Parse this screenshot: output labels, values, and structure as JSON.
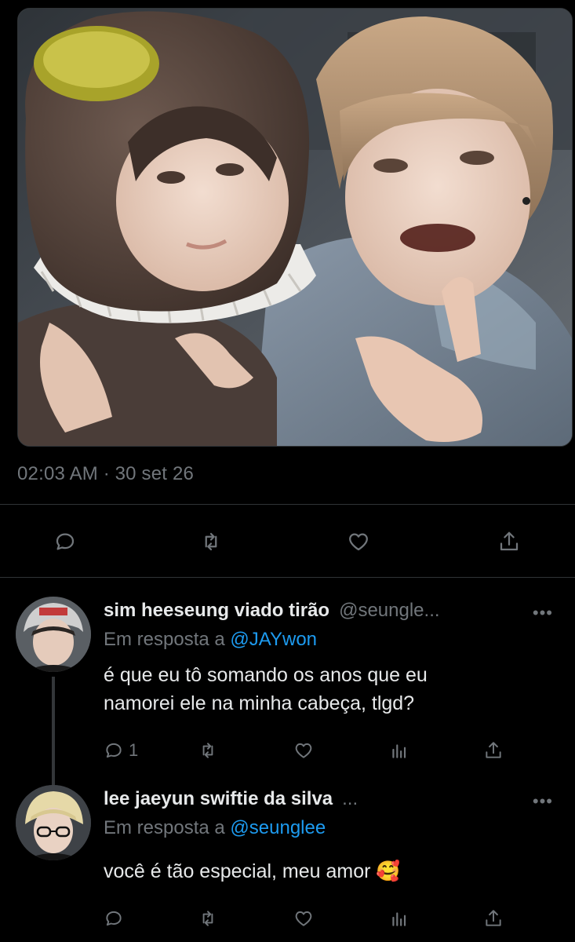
{
  "tweet": {
    "time": "02:03 AM",
    "separator": "·",
    "date": "30 set 26",
    "actions": [
      "reply-icon",
      "retweet-icon",
      "like-icon",
      "share-icon"
    ]
  },
  "replies": [
    {
      "author": "sim heeseung viado tirão",
      "handle": "@seungle...",
      "more": "•••",
      "reply_prefix": "Em resposta a",
      "reply_to": "@JAYwon",
      "lines": [
        "é que eu tô somando os anos que eu",
        "namorei ele na minha cabeça, tlgd?"
      ],
      "reply_count": "1"
    },
    {
      "author": "lee jaeyun swiftie da silva",
      "handle": "...",
      "more": "•••",
      "reply_prefix": "Em resposta a",
      "reply_to": "@seunglee",
      "text": "você é tão especial, meu amor 🥰"
    }
  ],
  "colors": {
    "background": "#000000",
    "text": "#e7e9ea",
    "muted": "#71767b",
    "link": "#1d9bf0",
    "border": "#2f3336"
  }
}
